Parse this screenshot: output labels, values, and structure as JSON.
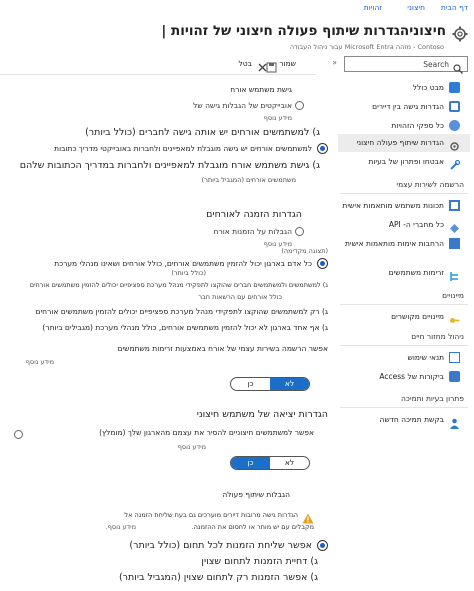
{
  "top_nav": {
    "links": [
      "דף הבית",
      "חיצוני",
      "זהויות"
    ]
  },
  "header": {
    "title": "חיצוניהגדרות שיתוף פעולה חיצוני של זהויות |",
    "subtitle": "Contoso - מזהה Microsoft Entra עבור ניהול העבודה"
  },
  "toolbar": {
    "save_label": "שמור",
    "discard_label": "בטל"
  },
  "sidebar": {
    "search_placeholder": "Search",
    "items": [
      {
        "label": "מבט כולל",
        "color": "#2f7bd8"
      },
      {
        "label": "הגדרות גישה בין דיירים",
        "color": "#3a78c9"
      },
      {
        "label": "כל ספקי הזהויות",
        "color": "#5a8fdc"
      },
      {
        "label": "הגדרות שיתוף פעולה חיצוני",
        "color": "#5f5f5f"
      },
      {
        "label": "אבטחו ופתרון של בעיות",
        "color": "#2f7bd8"
      }
    ],
    "sections": [
      {
        "title": "הרשמה לשירות עצמי",
        "items": [
          {
            "label": "תכונות משתמש מותאמות אישית",
            "color": "#3a78c9"
          },
          {
            "label": "כל מחברי ה- API",
            "color": "#5a8fdc"
          },
          {
            "label": "הרחבות אימות מותאמות אישית",
            "color": "#3a78c9"
          },
          {
            "label": "זרימות משתמשים",
            "color": "#2fa0d8"
          }
        ]
      },
      {
        "title": "מיינויים",
        "items": [
          {
            "label": "מיינויים מקושרים",
            "color": "#e8b62a"
          }
        ]
      },
      {
        "title": "ניהול מחזור חיים",
        "items": [
          {
            "label": "תנאי שימוש",
            "color": "#2f7bd8"
          },
          {
            "label": "ביקורות של Access",
            "color": "#3a78c9"
          }
        ]
      },
      {
        "title": "פתרון בעיות ותמיכה",
        "items": [
          {
            "label": "בקשת תמיכה חדשה",
            "color": "#2f7bd8"
          }
        ]
      }
    ]
  },
  "guest_access": {
    "heading": "גישת משתמש אורח",
    "sub": "אובייקטים של הגבלות גישה של",
    "more_info": "מידע נוסף",
    "options": [
      "ג) למשתמשים אורחים יש אותה גישה לחברים (כולל ביותר)",
      "למשתמשים אורחים יש גישה מוגבלת למאפיינים ולחברות באובייקטי מדריך כתובות",
      "ג) גישת משתמש אורח מוגבלת למאפיינים ולחברות במדריך הכתובות שלהם"
    ],
    "option3_note": "משתמשים אורחים (המגביל ביותר)",
    "selected_index": 1
  },
  "guest_invite": {
    "heading": "הגדרות הזמנה לאורחים",
    "sub": "הגבלות על הזמנות אורח",
    "more_info": "מידע נוסף",
    "preview_tag": "(תצוגה מקדימה)",
    "options": [
      "כל אדם בארגון יכול להזמין משתמשים אורחים, כולל אורחים ושאינו מנהלי מערכת",
      "(כולל ביותר)",
      "ג) למשתמשים ולמשתמשים חברים שהוקצו לתפקידי מנהל מערכת ספציפיים יכולים להזמין משתמשים אורחים",
      "כולל אורחים עם הרשאות חבר",
      "ג) רק למשתמשים שהוקצו לתפקידי מנהל מערכת ספציפיים יכולים להזמין משתמשים אורחים",
      "ג) אף אחד בארגון לא יכול להזמין משתמשים אורחים, כולל מנהלי מערכת (מגבילים ביותר)"
    ],
    "selected_index": 0
  },
  "self_service": {
    "label": "אפשר הרשמה בשירות עצמי של אורח באמצעות זרימות משתמשים",
    "more_info": "מידע נוסף",
    "yes": "כן",
    "no": "לא",
    "value": "no"
  },
  "external_leave": {
    "heading": "הגדרות יציאה של משתמש חיצוני",
    "label": "אפשר למשתמשים חיצוניים להסיר את עצמם מהארגון שלך (מומלץ)",
    "more_info": "מידע נוסף",
    "yes": "כן",
    "no": "לא",
    "value": "yes"
  },
  "collab_restrictions": {
    "heading": "הגבלות שיתוף פעולה",
    "warning": "הגדרות גישה מרובות דיירים מוערכים גם בעת שליחת הזמנה אל",
    "warning2": "מקבלים עם יש מותר או לחסום את ההזמנה.",
    "more_info": "מידע נוסף.",
    "options": [
      "אפשר שליחת הזמנות לכל תחום (כולל ביותר)",
      "ג) דחיית הזמנות לתחום שצוין",
      "ג) אפשר הזמנות רק לתחום שצוין (המגביל ביותר)"
    ],
    "selected_index": 0
  }
}
